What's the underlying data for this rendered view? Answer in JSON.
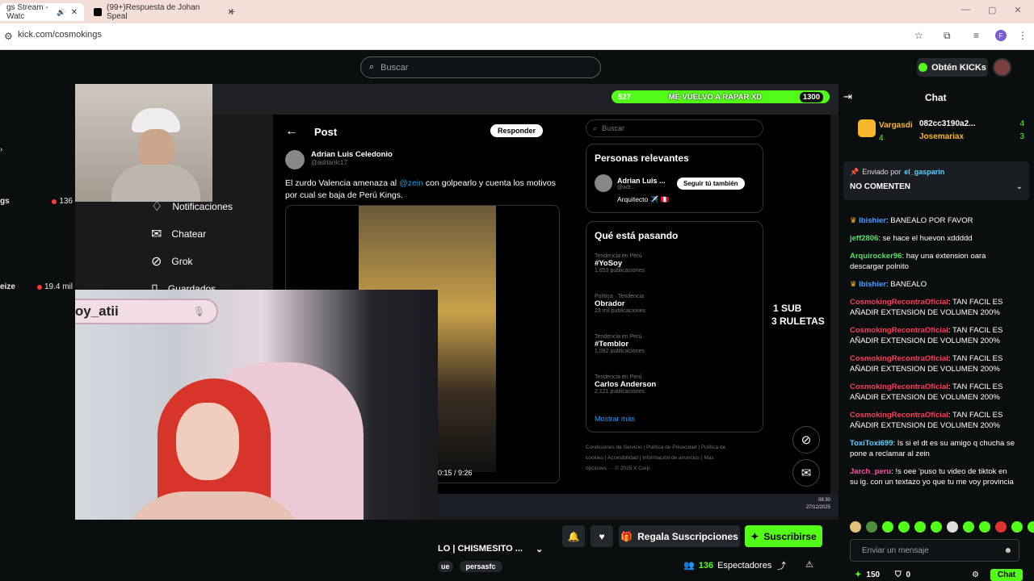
{
  "browser": {
    "tabs": [
      {
        "label": "gs Stream - Watc"
      },
      {
        "label": "(99+)Respuesta de Johan Speal"
      }
    ],
    "url": "kick.com/cosmokings"
  },
  "kick": {
    "search_placeholder": "Buscar",
    "kicks_label": "Obtén KICKs"
  },
  "left_rail": {
    "channels": [
      {
        "name": "gs",
        "viewers": "136"
      },
      {
        "name": "eize",
        "viewers": "19.4 mil"
      }
    ]
  },
  "stream": {
    "overlay_bar": {
      "left": "527",
      "title": "ME VUELVO A RAPAR XD",
      "right": "1300"
    },
    "x_nav": [
      "Notificaciones",
      "Chatear",
      "Grok",
      "Guardados"
    ],
    "post_header": "Post",
    "respond_label": "Responder",
    "author_name": "Adrian Luis Celedonio",
    "author_handle": "@adrianlc17",
    "post_text_1": "El zurdo Valencia amenaza al ",
    "post_mention": "@zein",
    "post_text_2": " con golpearlo y cuenta los motivos por cual se baja de Perú Kings.",
    "video_time": "0:15 / 9:26",
    "x_search": "Buscar",
    "relevant_title": "Personas relevantes",
    "relevant_name": "Adrian Luis ...",
    "relevant_handle": "@adr...",
    "follow_label": "Seguir tú también",
    "relevant_bio": "Arquitecto ✈️ 🇵🇪",
    "trending_title": "Qué está pasando",
    "trends": [
      {
        "meta": "Tendencia en Perú",
        "name": "#YoSoy",
        "posts": "1,653 publicaciones"
      },
      {
        "meta": "Política · Tendencia",
        "name": "Obrador",
        "posts": "23 mil publicaciones"
      },
      {
        "meta": "Tendencia en Perú",
        "name": "#Temblor",
        "posts": "1,082 publicaciones"
      },
      {
        "meta": "Tendencia en Perú",
        "name": "Carlos Anderson",
        "posts": "2,121 publicaciones"
      }
    ],
    "show_more": "Mostrar más",
    "footer_links": "Condiciones de Servicio | Política de Privacidad | Política de cookies | Accesibilidad | Información de anuncios | Más opciones ··· © 2025 X Corp.",
    "sub_text": "1 SUB",
    "roulette_text": "3 RULETAS",
    "instagram": "@soy_atii",
    "clock": "08:30",
    "date": "27/12/2025"
  },
  "info": {
    "title": "LO | CHISMESITO ...",
    "tags": [
      "ue",
      "persasfc"
    ],
    "gift_label": "Regala Suscripciones",
    "subscribe_label": "Suscribirse",
    "viewers": "136",
    "viewers_label": "Espectadores"
  },
  "chat": {
    "title": "Chat",
    "leaders": [
      {
        "name": "Vargasdi",
        "count": "4"
      },
      {
        "name": "082cc3190a2...",
        "count": "4"
      },
      {
        "name": "Josemariax",
        "count": "3"
      }
    ],
    "pinned_by_label": "Enviado por",
    "pinned_by": "el_gasparin",
    "pinned_text": "NO COMENTEN",
    "messages": [
      {
        "user": "Ibishier",
        "color": "#4c9dff",
        "text": ": BANEALO POR FAVOR"
      },
      {
        "user": "jeff2806",
        "color": "#56e06b",
        "text": ": se hace el huevon xddddd"
      },
      {
        "user": "Arquirocker96",
        "color": "#56e06b",
        "text": ": hay una extension oara descargar polnito"
      },
      {
        "user": "Ibishier",
        "color": "#4c9dff",
        "text": ": BANEALO"
      },
      {
        "user": "CosmokingRecontraOficial",
        "color": "#ff3b5c",
        "text": ": TAN FACIL ES AÑADIR EXTENSION DE VOLUMEN 200%"
      },
      {
        "user": "CosmokingRecontraOficial",
        "color": "#ff3b5c",
        "text": ": TAN FACIL ES AÑADIR EXTENSION DE VOLUMEN 200%"
      },
      {
        "user": "CosmokingRecontraOficial",
        "color": "#ff3b5c",
        "text": ": TAN FACIL ES AÑADIR EXTENSION DE VOLUMEN 200%"
      },
      {
        "user": "CosmokingRecontraOficial",
        "color": "#ff3b5c",
        "text": ": TAN FACIL ES AÑADIR EXTENSION DE VOLUMEN 200%"
      },
      {
        "user": "CosmokingRecontraOficial",
        "color": "#ff3b5c",
        "text": ": TAN FACIL ES AÑADIR EXTENSION DE VOLUMEN 200%"
      },
      {
        "user": "ToxiToxi699",
        "color": "#5fd0ff",
        "text": ": Is si el dt es su amigo q chucha se pone a reclamar al zein"
      },
      {
        "user": "Jarch_peru",
        "color": "#ff4fa3",
        "text": ": !s oee 'puso tu video de tiktok en su ig. con un textazo yo que tu me voy provincia"
      }
    ],
    "input_placeholder": "Enviar un mensaje",
    "points": "150",
    "badges": "0",
    "send_label": "Chat"
  },
  "colors": {
    "accent": "#53fc18",
    "bg": "#0b0e0f"
  }
}
